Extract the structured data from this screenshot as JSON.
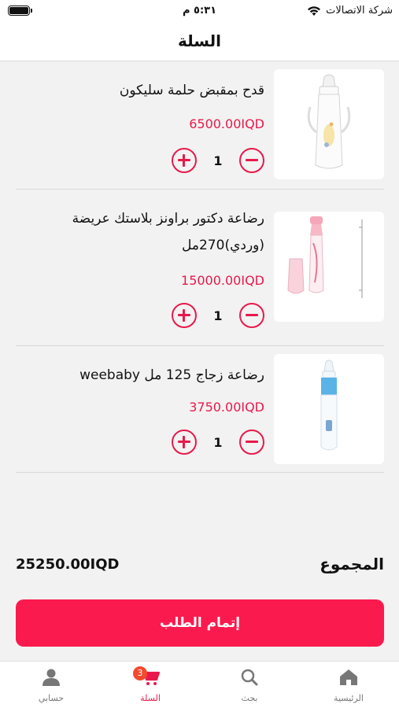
{
  "status_bar": {
    "time": "٥:٣١ م",
    "carrier": "شركة الاتصالات"
  },
  "header": {
    "title": "السلة"
  },
  "cart": {
    "items": [
      {
        "name": "قدح بمقبض حلمة سليكون",
        "price": "6500.00IQD",
        "quantity": "1"
      },
      {
        "name": "رضاعة دكتور براونز بلاستك عريضة (وردي)270مل",
        "price": "15000.00IQD",
        "quantity": "1"
      },
      {
        "name": "رضاعة زجاج 125 مل weebaby",
        "price": "3750.00IQD",
        "quantity": "1"
      }
    ]
  },
  "summary": {
    "total_label": "المجموع",
    "total_value": "25250.00IQD"
  },
  "checkout": {
    "label": "إتمام الطلب"
  },
  "bottom_nav": {
    "home": "الرئيسية",
    "search": "بحث",
    "cart": "السلة",
    "cart_badge": "3",
    "account": "حسابي"
  },
  "colors": {
    "accent": "#e8194a",
    "button": "#fb1a4e",
    "badge": "#f44a2e"
  }
}
